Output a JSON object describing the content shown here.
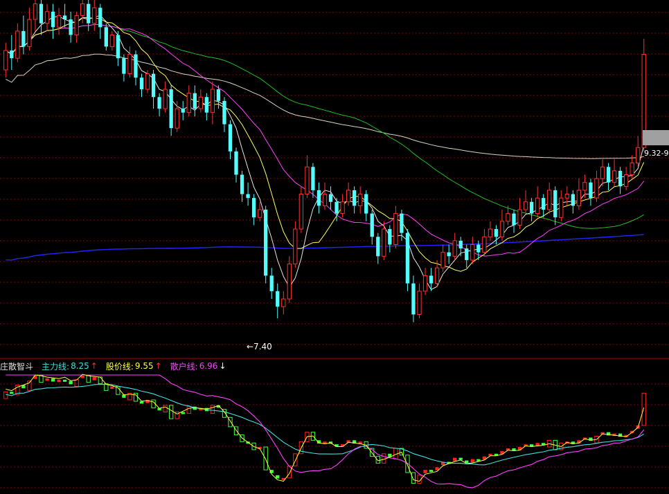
{
  "colors": {
    "background": "#000000",
    "grid": "#8b0000",
    "up": "#ff3232",
    "down": "#54fcfc",
    "ma_white": "#e8e8e8",
    "ma_yellow": "#ffff60",
    "ma_magenta": "#ff40ff",
    "ma_green": "#20c020",
    "ma_blue": "#2424ff",
    "ma_long": "#d8d8c0",
    "ind_up_bar": "#ff2020",
    "ind_down_bar": "#40ff40",
    "ind_main_line": "#40e0e0",
    "ind_price_line": "#ffff40",
    "ind_retail_line": "#ff40ff"
  },
  "price_panel": {
    "low_marker_label": "←7.40",
    "right_price_label": "9.32-9",
    "ylim": [
      7.0,
      11.5
    ]
  },
  "indicator_panel": {
    "name": "庄散智斗",
    "main_line": {
      "label": "主力线:",
      "value": "8.25",
      "arrow": "↑",
      "color": "#40e0e0"
    },
    "price_line": {
      "label": "股价线:",
      "value": "9.55",
      "arrow": "↑",
      "color": "#ffff40"
    },
    "retail_line": {
      "label": "散户线:",
      "value": "6.96",
      "arrow": "↓",
      "color": "#ff40ff"
    },
    "arrow_colors": {
      "up": "#ff3030",
      "down": "#ffffff"
    }
  },
  "chart_data": [
    {
      "type": "candlestick",
      "title": "",
      "xlabel": "",
      "ylabel": "",
      "grid": true,
      "annotations": [
        "←7.40",
        "9.32-9"
      ],
      "candles": [
        [
          10.6,
          10.85,
          10.95,
          10.5
        ],
        [
          10.85,
          10.75,
          11.05,
          10.6
        ],
        [
          10.75,
          11.1,
          11.2,
          10.7
        ],
        [
          11.1,
          10.9,
          11.3,
          10.8
        ],
        [
          10.9,
          11.25,
          11.4,
          10.85
        ],
        [
          11.25,
          11.45,
          11.55,
          11.1
        ],
        [
          11.45,
          11.2,
          11.55,
          11.05
        ],
        [
          11.2,
          11.35,
          11.45,
          11.1
        ],
        [
          11.35,
          11.15,
          11.45,
          11.0
        ],
        [
          11.15,
          11.3,
          11.4,
          11.05
        ],
        [
          11.3,
          11.25,
          11.45,
          11.15
        ],
        [
          11.25,
          11.05,
          11.35,
          10.95
        ],
        [
          11.05,
          11.3,
          11.35,
          10.95
        ],
        [
          11.3,
          11.45,
          11.55,
          11.2
        ],
        [
          11.45,
          11.2,
          11.55,
          11.1
        ],
        [
          11.2,
          11.4,
          11.5,
          11.1
        ],
        [
          11.4,
          11.15,
          11.45,
          11.0
        ],
        [
          11.15,
          10.9,
          11.2,
          10.85
        ],
        [
          10.9,
          11.05,
          11.1,
          10.85
        ],
        [
          11.05,
          10.75,
          11.1,
          10.65
        ],
        [
          10.75,
          10.55,
          10.8,
          10.45
        ],
        [
          10.55,
          10.8,
          10.9,
          10.5
        ],
        [
          10.8,
          10.5,
          10.85,
          10.4
        ],
        [
          10.5,
          10.35,
          10.55,
          10.25
        ],
        [
          10.35,
          10.55,
          10.6,
          10.3
        ],
        [
          10.55,
          10.25,
          10.6,
          10.1
        ],
        [
          10.25,
          10.1,
          10.3,
          10.0
        ],
        [
          10.1,
          10.35,
          10.45,
          10.05
        ],
        [
          10.35,
          9.85,
          10.4,
          9.75
        ],
        [
          9.85,
          10.1,
          10.2,
          9.8
        ],
        [
          10.1,
          10.05,
          10.2,
          9.95
        ],
        [
          10.05,
          10.3,
          10.4,
          10.0
        ],
        [
          10.3,
          10.1,
          10.4,
          10.0
        ],
        [
          10.1,
          10.25,
          10.35,
          10.05
        ],
        [
          10.25,
          10.05,
          10.3,
          9.95
        ],
        [
          10.05,
          10.35,
          10.45,
          9.9
        ],
        [
          10.35,
          10.2,
          10.4,
          10.1
        ],
        [
          10.2,
          9.9,
          10.25,
          9.8
        ],
        [
          9.9,
          9.55,
          9.95,
          9.45
        ],
        [
          9.55,
          9.25,
          9.6,
          9.15
        ],
        [
          9.25,
          9.0,
          9.3,
          8.9
        ],
        [
          9.0,
          8.95,
          9.15,
          8.85
        ],
        [
          8.95,
          8.7,
          9.0,
          8.6
        ],
        [
          8.7,
          8.8,
          8.9,
          8.65
        ],
        [
          8.8,
          7.95,
          8.85,
          7.85
        ],
        [
          7.95,
          7.75,
          8.05,
          7.65
        ],
        [
          7.75,
          7.55,
          7.85,
          7.4
        ],
        [
          7.55,
          7.65,
          7.75,
          7.45
        ],
        [
          7.65,
          8.1,
          8.2,
          7.6
        ],
        [
          8.1,
          8.55,
          8.65,
          8.05
        ],
        [
          8.55,
          9.0,
          9.1,
          8.5
        ],
        [
          9.0,
          9.35,
          9.5,
          8.95
        ],
        [
          9.35,
          9.05,
          9.4,
          8.95
        ],
        [
          9.05,
          8.85,
          9.15,
          8.75
        ],
        [
          8.85,
          9.0,
          9.15,
          8.8
        ],
        [
          9.0,
          8.9,
          9.1,
          8.8
        ],
        [
          8.9,
          8.75,
          8.95,
          8.65
        ],
        [
          8.75,
          8.9,
          9.0,
          8.7
        ],
        [
          8.9,
          9.05,
          9.15,
          8.85
        ],
        [
          9.05,
          8.85,
          9.1,
          8.75
        ],
        [
          8.85,
          9.0,
          9.1,
          8.75
        ],
        [
          9.0,
          8.75,
          9.05,
          8.65
        ],
        [
          8.75,
          8.45,
          8.8,
          8.35
        ],
        [
          8.45,
          8.2,
          8.5,
          8.1
        ],
        [
          8.2,
          8.55,
          8.65,
          8.15
        ],
        [
          8.55,
          8.35,
          8.6,
          8.25
        ],
        [
          8.35,
          8.75,
          8.85,
          8.3
        ],
        [
          8.75,
          8.5,
          8.8,
          8.4
        ],
        [
          8.5,
          7.85,
          8.55,
          7.75
        ],
        [
          7.85,
          7.45,
          7.95,
          7.35
        ],
        [
          7.45,
          7.75,
          7.85,
          7.4
        ],
        [
          7.75,
          7.95,
          8.05,
          7.7
        ],
        [
          7.95,
          7.85,
          8.05,
          7.75
        ],
        [
          7.85,
          8.05,
          8.15,
          7.8
        ],
        [
          8.05,
          8.25,
          8.35,
          8.0
        ],
        [
          8.25,
          8.2,
          8.35,
          8.1
        ],
        [
          8.2,
          8.4,
          8.5,
          8.15
        ],
        [
          8.4,
          8.3,
          8.45,
          8.2
        ],
        [
          8.3,
          8.15,
          8.35,
          8.05
        ],
        [
          8.15,
          8.35,
          8.45,
          8.1
        ],
        [
          8.35,
          8.25,
          8.4,
          8.15
        ],
        [
          8.25,
          8.45,
          8.55,
          8.2
        ],
        [
          8.45,
          8.55,
          8.65,
          8.4
        ],
        [
          8.55,
          8.45,
          8.6,
          8.35
        ],
        [
          8.45,
          8.65,
          8.8,
          8.4
        ],
        [
          8.65,
          8.75,
          8.85,
          8.6
        ],
        [
          8.75,
          8.6,
          8.8,
          8.5
        ],
        [
          8.6,
          8.8,
          8.95,
          8.55
        ],
        [
          8.8,
          8.9,
          9.05,
          8.75
        ],
        [
          8.9,
          8.75,
          8.95,
          8.65
        ],
        [
          8.75,
          8.95,
          9.1,
          8.7
        ],
        [
          8.95,
          8.8,
          9.0,
          8.7
        ],
        [
          8.8,
          9.05,
          9.15,
          8.75
        ],
        [
          9.05,
          8.7,
          9.1,
          8.6
        ],
        [
          8.7,
          8.95,
          9.05,
          8.65
        ],
        [
          8.95,
          9.0,
          9.1,
          8.85
        ],
        [
          9.0,
          8.85,
          9.05,
          8.75
        ],
        [
          8.85,
          9.05,
          9.2,
          8.8
        ],
        [
          9.05,
          9.15,
          9.25,
          8.95
        ],
        [
          9.15,
          8.95,
          9.2,
          8.85
        ],
        [
          8.95,
          9.2,
          9.3,
          8.9
        ],
        [
          9.2,
          9.35,
          9.45,
          9.1
        ],
        [
          9.35,
          9.15,
          9.4,
          9.05
        ],
        [
          9.15,
          9.3,
          9.45,
          9.1
        ],
        [
          9.3,
          9.1,
          9.35,
          9.0
        ],
        [
          9.1,
          9.25,
          9.35,
          9.05
        ],
        [
          9.25,
          9.4,
          9.5,
          9.2
        ],
        [
          9.4,
          9.6,
          9.75,
          9.35
        ],
        [
          9.6,
          10.8,
          11.0,
          9.55
        ]
      ]
    },
    {
      "type": "bar",
      "title": "庄散智斗",
      "series": [
        {
          "name": "主力线",
          "last": 8.25
        },
        {
          "name": "股价线",
          "last": 9.55
        },
        {
          "name": "散户线",
          "last": 6.96
        }
      ]
    }
  ]
}
